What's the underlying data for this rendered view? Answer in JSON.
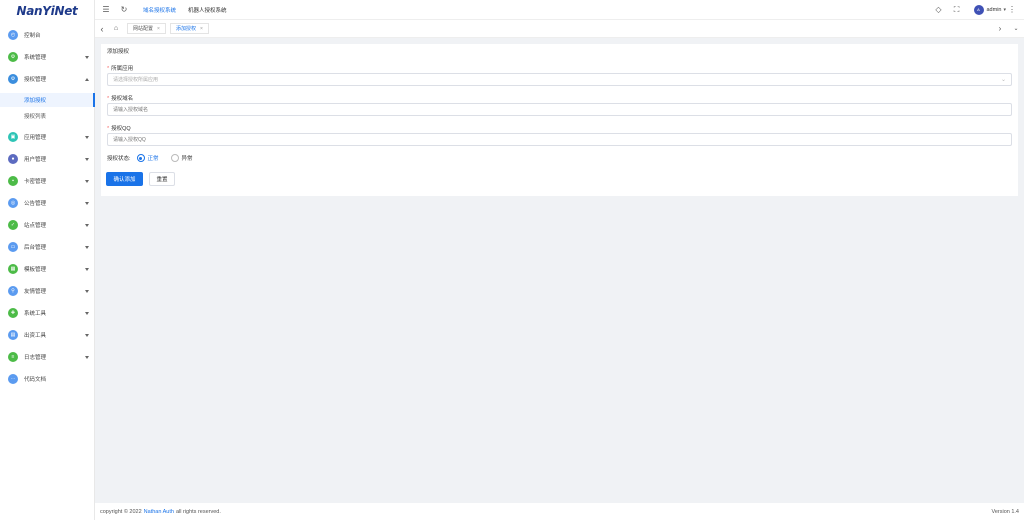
{
  "logo": "NanYiNet",
  "sidebar": {
    "items": [
      {
        "label": "控制台",
        "color": "#5b9bf0",
        "has_caret": false
      },
      {
        "label": "系统管理",
        "color": "#4cbb47",
        "has_caret": true
      },
      {
        "label": "授权管理",
        "color": "#3b8ede",
        "has_caret": true,
        "expanded": true
      },
      {
        "label": "应用管理",
        "color": "#2ec4b6",
        "has_caret": true
      },
      {
        "label": "用户管理",
        "color": "#5c6bc0",
        "has_caret": true
      },
      {
        "label": "卡密管理",
        "color": "#4cbb47",
        "has_caret": true
      },
      {
        "label": "公告管理",
        "color": "#5b9bf0",
        "has_caret": true
      },
      {
        "label": "站点管理",
        "color": "#4cbb47",
        "has_caret": true
      },
      {
        "label": "后台管理",
        "color": "#5b9bf0",
        "has_caret": true
      },
      {
        "label": "模板管理",
        "color": "#4cbb47",
        "has_caret": true
      },
      {
        "label": "友情管理",
        "color": "#5b9bf0",
        "has_caret": true
      },
      {
        "label": "系统工具",
        "color": "#4cbb47",
        "has_caret": true
      },
      {
        "label": "出资工具",
        "color": "#5b9bf0",
        "has_caret": true
      },
      {
        "label": "日志管理",
        "color": "#4cbb47",
        "has_caret": true
      },
      {
        "label": "代码文档",
        "color": "#5b9bf0",
        "has_caret": false
      }
    ],
    "sub_items": [
      "添加授权",
      "授权列表"
    ]
  },
  "topbar": {
    "nav": [
      "域名授权系统",
      "机器人授权系统"
    ],
    "user": "admin"
  },
  "tabs": [
    "网站配置",
    "添加授权"
  ],
  "form": {
    "title": "添加授权",
    "app_label": "所属应用",
    "app_placeholder": "请选择授权所属应用",
    "domain_label": "授权域名",
    "domain_placeholder": "请输入授权域名",
    "qq_label": "授权QQ",
    "qq_placeholder": "请输入授权QQ",
    "status_label": "授权状态:",
    "status_options": [
      "正常",
      "异常"
    ],
    "status_selected": "正常",
    "submit": "确认添加",
    "reset": "重置"
  },
  "footer": {
    "prefix": "copyright © 2022",
    "brand": "Nathan Auth",
    "suffix": "all rights reserved.",
    "version": "Version 1.4"
  },
  "colors": {
    "accent": "#1a73e8",
    "required": "#f56c6c"
  }
}
